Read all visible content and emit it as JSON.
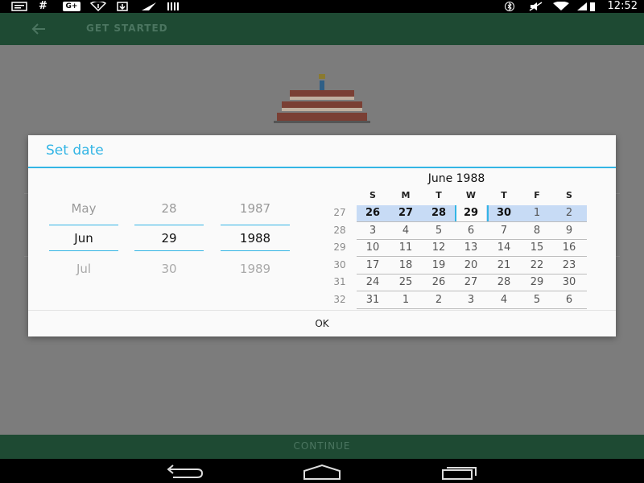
{
  "status_bar": {
    "time": "12:52",
    "icons": [
      "message-icon",
      "hash-icon",
      "google-plus-icon",
      "signal-icon",
      "download-icon",
      "share-icon",
      "barcode-icon",
      "bluetooth-icon",
      "mute-icon",
      "wifi-icon",
      "cell-signal-icon",
      "battery-icon"
    ],
    "hash_glyph": "#",
    "gplus_glyph": "G+"
  },
  "app_bar": {
    "title": "GET STARTED",
    "color": "#1e4a33"
  },
  "footer": {
    "continue_label": "CONTINUE"
  },
  "dialog": {
    "title": "Set date",
    "accent_color": "#33b5e5",
    "ok_label": "OK",
    "spinners": {
      "month": {
        "prev": "May",
        "current": "Jun",
        "next": "Jul"
      },
      "day": {
        "prev": "28",
        "current": "29",
        "next": "30"
      },
      "year": {
        "prev": "1987",
        "current": "1988",
        "next": "1989"
      }
    },
    "calendar": {
      "month_title": "June 1988",
      "weekday_headers": [
        "S",
        "M",
        "T",
        "W",
        "T",
        "F",
        "S"
      ],
      "weeks": [
        {
          "number": "27",
          "days": [
            "26",
            "27",
            "28",
            "29",
            "30",
            "1",
            "2"
          ]
        },
        {
          "number": "28",
          "days": [
            "3",
            "4",
            "5",
            "6",
            "7",
            "8",
            "9"
          ]
        },
        {
          "number": "29",
          "days": [
            "10",
            "11",
            "12",
            "13",
            "14",
            "15",
            "16"
          ]
        },
        {
          "number": "30",
          "days": [
            "17",
            "18",
            "19",
            "20",
            "21",
            "22",
            "23"
          ]
        },
        {
          "number": "31",
          "days": [
            "24",
            "25",
            "26",
            "27",
            "28",
            "29",
            "30"
          ]
        },
        {
          "number": "32",
          "days": [
            "31",
            "1",
            "2",
            "3",
            "4",
            "5",
            "6"
          ]
        }
      ],
      "selected_date": "29"
    }
  }
}
